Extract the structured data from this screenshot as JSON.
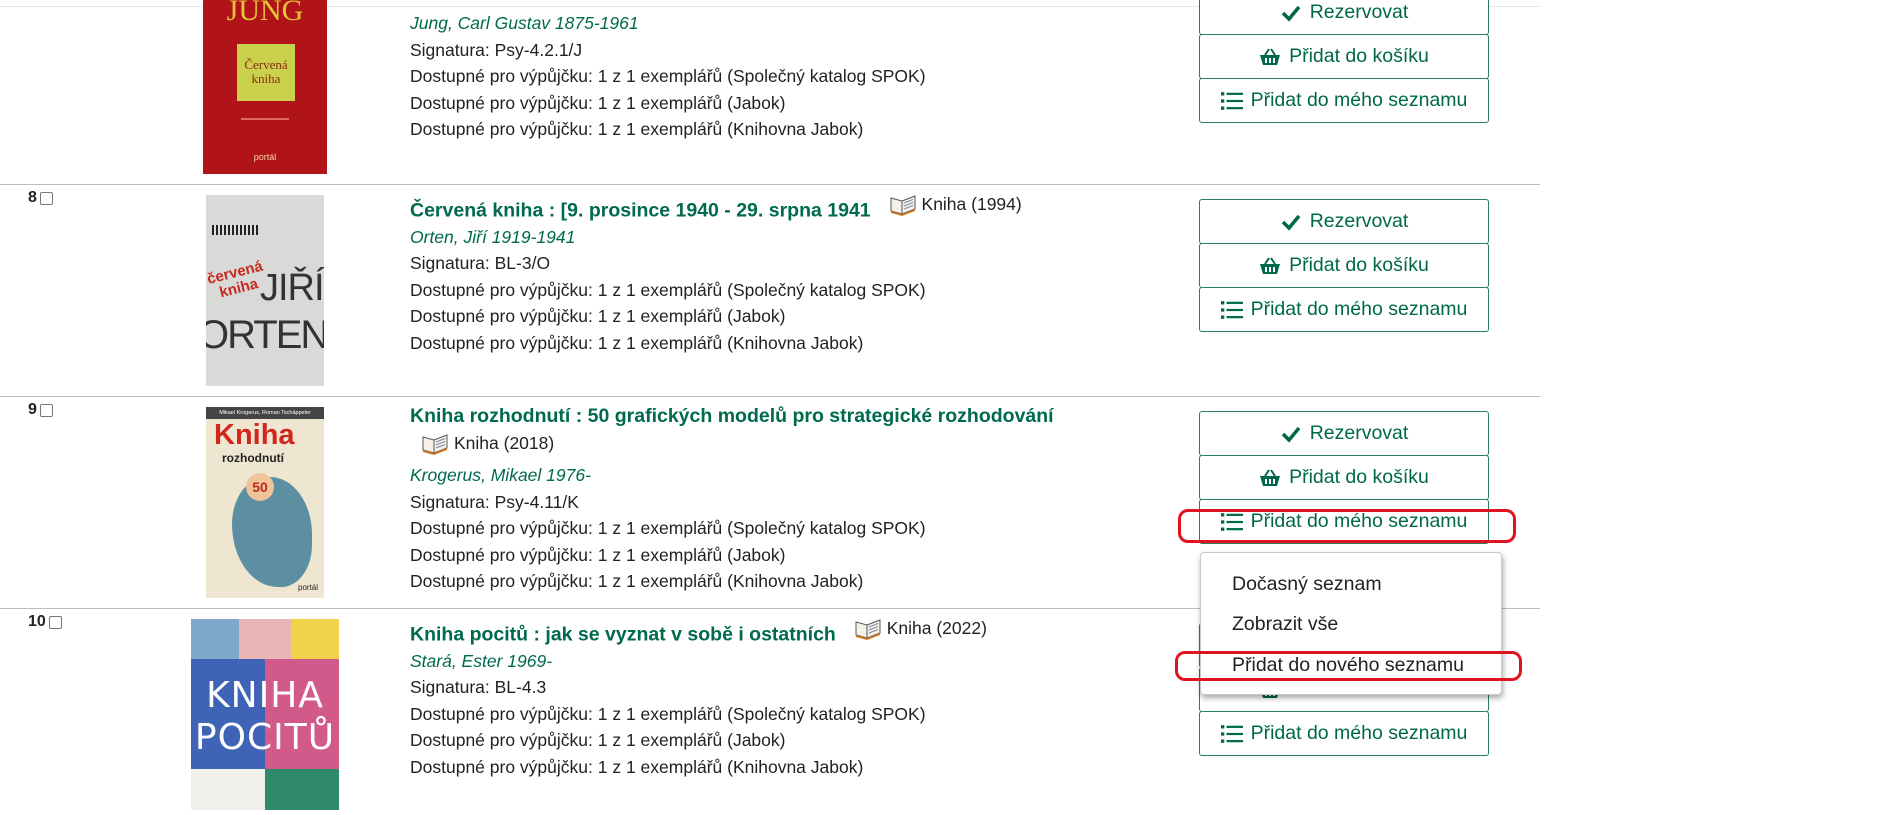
{
  "results": [
    {
      "number": "",
      "title": "",
      "format": "",
      "author": "Jung, Carl Gustav 1875-1961",
      "signature": "Signatura: Psy-4.2.1/J",
      "availability": [
        "Dostupné pro výpůjčku: 1 z 1 exemplářů (Společný katalog SPOK)",
        "Dostupné pro výpůjčku: 1 z 1 exemplářů (Jabok)",
        "Dostupné pro výpůjčku: 1 z 1 exemplářů (Knihovna Jabok)"
      ],
      "cover": {
        "top_text": "JUNG",
        "small_text": "Červená kniha",
        "publisher": "portál",
        "colors": {
          "bg": "#b01419",
          "panel": "#c9d24a"
        }
      }
    },
    {
      "number": "8",
      "title": "Červená kniha : [9. prosince 1940 - 29. srpna 1941",
      "format": "Kniha (1994)",
      "author": "Orten, Jiří 1919-1941",
      "signature": "Signatura: BL-3/O",
      "availability": [
        "Dostupné pro výpůjčku: 1 z 1 exemplářů (Společný katalog SPOK)",
        "Dostupné pro výpůjčku: 1 z 1 exemplářů (Jabok)",
        "Dostupné pro výpůjčku: 1 z 1 exemplářů (Knihovna Jabok)"
      ],
      "cover": {
        "red_text": "červená kniha",
        "name1": "JIŘÍ",
        "name2": "ORTEN"
      }
    },
    {
      "number": "9",
      "title": "Kniha rozhodnutí : 50 grafických modelů pro strategické rozhodování",
      "format": "Kniha (2018)",
      "author": "Krogerus, Mikael 1976-",
      "signature": "Signatura: Psy-4.11/K",
      "availability": [
        "Dostupné pro výpůjčku: 1 z 1 exemplářů (Společný katalog SPOK)",
        "Dostupné pro výpůjčku: 1 z 1 exemplářů (Jabok)",
        "Dostupné pro výpůjčku: 1 z 1 exemplářů (Knihovna Jabok)"
      ],
      "cover": {
        "authors": "Mikael Krogerus, Roman Tschäppeler",
        "big": "Kniha",
        "sub": "rozhodnutí",
        "fifty": "50",
        "publisher": "portál"
      }
    },
    {
      "number": "10",
      "title": "Kniha pocitů : jak se vyznat v sobě i ostatních",
      "format": "Kniha (2022)",
      "author": "Stará, Ester 1969-",
      "signature": "Signatura: BL-4.3",
      "availability": [
        "Dostupné pro výpůjčku: 1 z 1 exemplářů (Společný katalog SPOK)",
        "Dostupné pro výpůjčku: 1 z 1 exemplářů (Jabok)",
        "Dostupné pro výpůjčku: 1 z 1 exemplářů (Knihovna Jabok)"
      ],
      "cover": {
        "line1": "KNIHA",
        "line2": "POCITŮ"
      }
    }
  ],
  "actions": {
    "reserve": "Rezervovat",
    "add_to_cart": "Přidat do košíku",
    "add_to_list": "Přidat do mého seznamu"
  },
  "dropdown": {
    "items": [
      "Dočasný seznam",
      "Zobrazit vše",
      "Přidat do nového seznamu"
    ]
  },
  "colors": {
    "accent": "#006a4e",
    "highlight": "#e0141e"
  },
  "icons": [
    "check-icon",
    "basket-icon",
    "list-icon",
    "book-icon",
    "checkbox"
  ]
}
